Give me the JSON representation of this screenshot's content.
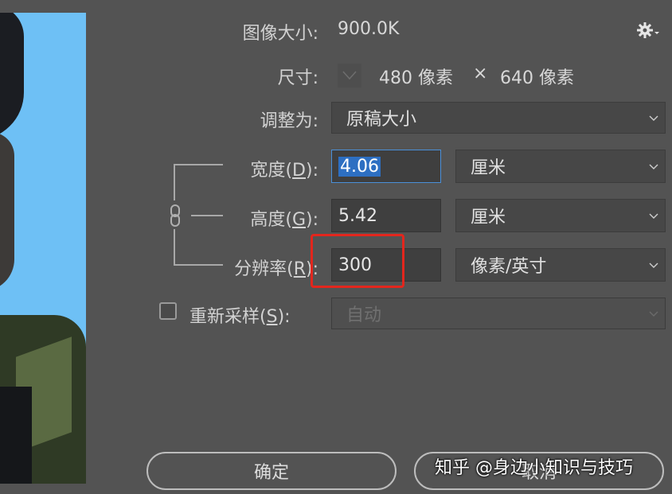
{
  "image_size": {
    "label": "图像大小:",
    "value": "900.0K"
  },
  "settings_icon": "gear-icon",
  "dimensions": {
    "label": "尺寸:",
    "width": "480 像素",
    "times": "×",
    "height": "640 像素"
  },
  "fit_to": {
    "label": "调整为:",
    "value": "原稿大小"
  },
  "width": {
    "label_prefix": "宽度(",
    "label_key": "D",
    "label_suffix": "):",
    "value": "4.06",
    "unit": "厘米"
  },
  "height": {
    "label_prefix": "高度(",
    "label_key": "G",
    "label_suffix": "):",
    "value": "5.42",
    "unit": "厘米"
  },
  "resolution": {
    "label_prefix": "分辨率(",
    "label_key": "R",
    "label_suffix": "):",
    "value": "300",
    "unit": "像素/英寸"
  },
  "resample": {
    "label_prefix": "重新采样(",
    "label_key": "S",
    "label_suffix": "):",
    "value": "自动",
    "checked": false
  },
  "buttons": {
    "ok": "确定",
    "cancel": "取消"
  },
  "watermark": "知乎 @身边小知识与技巧",
  "colors": {
    "highlight": "#e3261d",
    "selection": "#2d6fc2",
    "preview_bg": "#6ec0f5"
  }
}
